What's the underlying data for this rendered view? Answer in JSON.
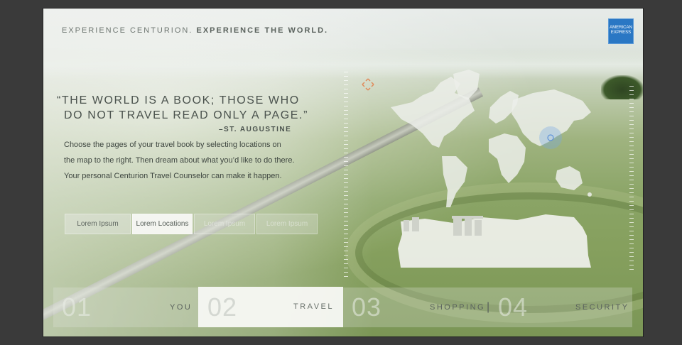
{
  "header": {
    "tagline_light": "EXPERIENCE CENTURION.",
    "tagline_bold": "EXPERIENCE THE WORLD.",
    "logo_text_1": "AMERICAN",
    "logo_text_2": "EXPRESS"
  },
  "quote": {
    "line1": "“THE WORLD IS A BOOK; THOSE WHO",
    "line2": "DO NOT TRAVEL READ ONLY A PAGE.”",
    "attribution": "–ST. AUGUSTINE"
  },
  "description": {
    "line1": "Choose the pages of your travel book by selecting locations on",
    "line2": "the map to the right. Then dream about what you’d like to do there.",
    "line3": "Your personal Centurion Travel Counselor can make it happen."
  },
  "buttons": [
    {
      "label": "Lorem Ipsum"
    },
    {
      "label": "Lorem Locations"
    },
    {
      "label": "Lorem Ipsum"
    },
    {
      "label": "Lorem Ipsum"
    }
  ],
  "nav": [
    {
      "number": "01",
      "label": "YOU"
    },
    {
      "number": "02",
      "label": "TRAVEL"
    },
    {
      "number": "03",
      "label": "SHOPPING"
    },
    {
      "number": "04",
      "label": "SECURITY"
    }
  ],
  "icons": {
    "crosshair": "crosshair-icon",
    "map_marker": "map-marker-icon",
    "logo": "amex-logo"
  },
  "colors": {
    "amex_blue": "#2a77c4",
    "text_dark": "#4a524d"
  }
}
